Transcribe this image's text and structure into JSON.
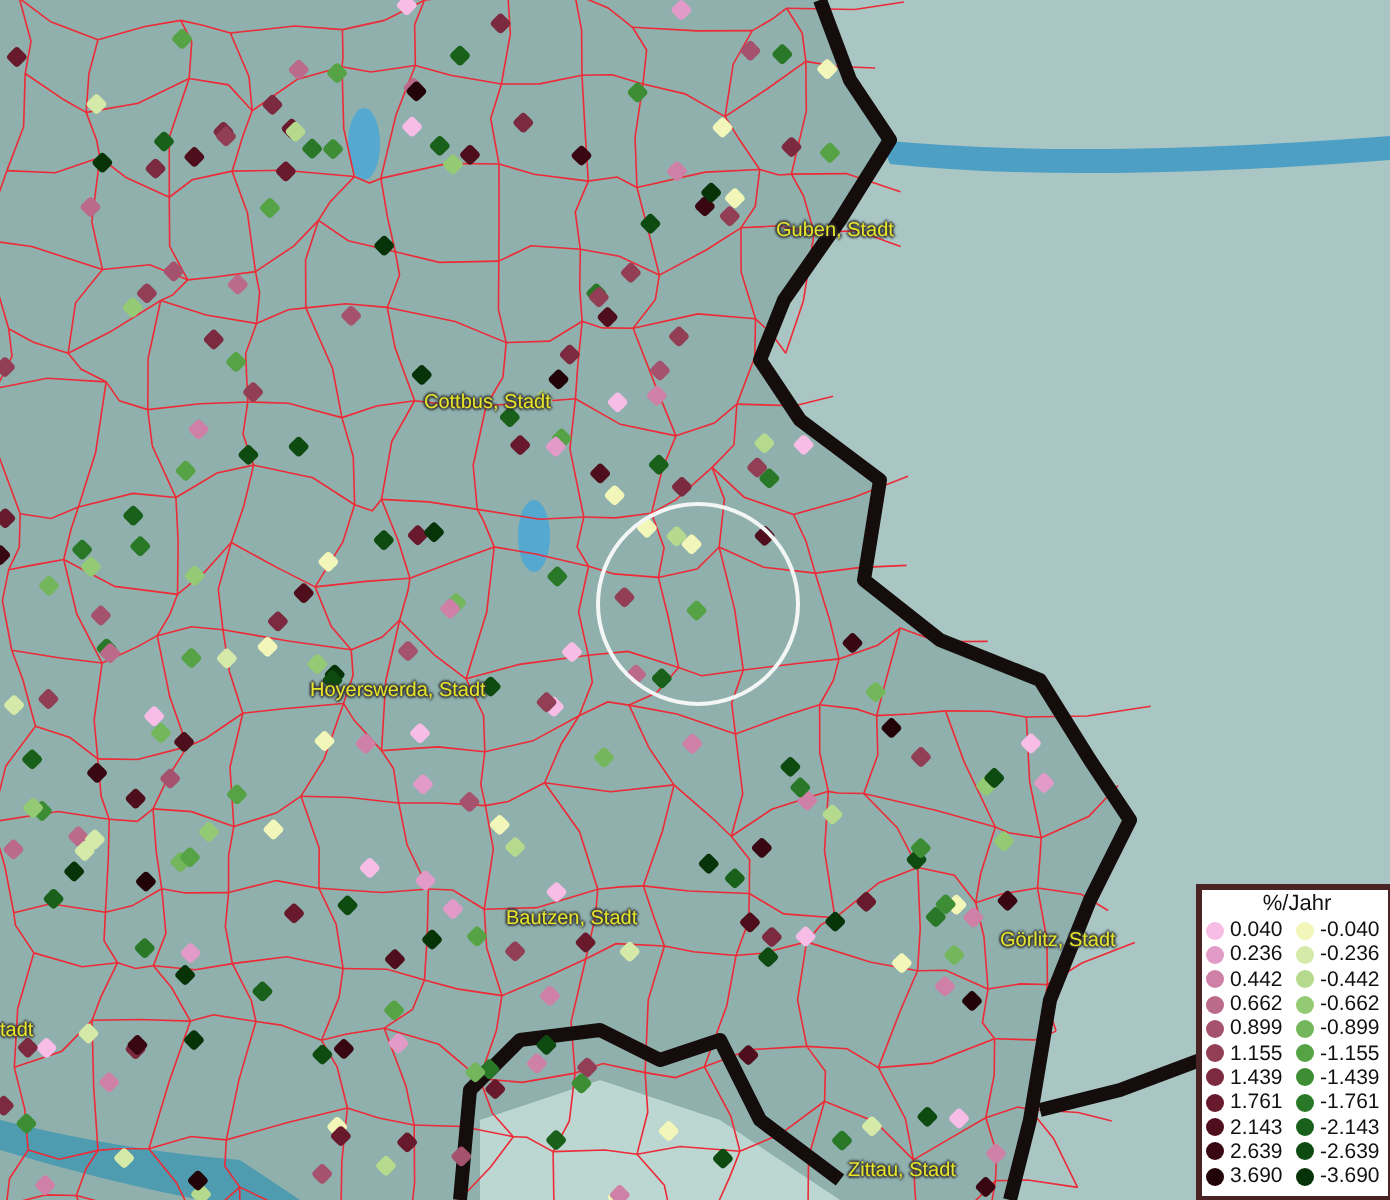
{
  "map": {
    "place_labels": [
      {
        "label": "Guben, Stadt"
      },
      {
        "label": "Cottbus, Stadt"
      },
      {
        "label": "Hoyerswerda, Stadt"
      },
      {
        "label": "tadt"
      },
      {
        "label": "Bautzen, Stadt"
      },
      {
        "label": "Görlitz, Stadt"
      },
      {
        "label": "Zittau, Stadt"
      }
    ]
  },
  "legend": {
    "title": "%/Jahr",
    "positive": [
      {
        "label": "0.040",
        "color": "#f7bde6"
      },
      {
        "label": "0.236",
        "color": "#e29bc8"
      },
      {
        "label": "0.442",
        "color": "#cf80a6"
      },
      {
        "label": "0.662",
        "color": "#bb6a8a"
      },
      {
        "label": "0.899",
        "color": "#a5526e"
      },
      {
        "label": "1.155",
        "color": "#923e55"
      },
      {
        "label": "1.439",
        "color": "#7c2a3f"
      },
      {
        "label": "1.761",
        "color": "#68192b"
      },
      {
        "label": "2.143",
        "color": "#4e0e1b"
      },
      {
        "label": "2.639",
        "color": "#380712"
      },
      {
        "label": "3.690",
        "color": "#210308"
      }
    ],
    "negative": [
      {
        "label": "-0.040",
        "color": "#f2f6b8"
      },
      {
        "label": "-0.236",
        "color": "#d5eaa8"
      },
      {
        "label": "-0.442",
        "color": "#b5da8d"
      },
      {
        "label": "-0.662",
        "color": "#94ca73"
      },
      {
        "label": "-0.899",
        "color": "#74b65b"
      },
      {
        "label": "-1.155",
        "color": "#56a346"
      },
      {
        "label": "-1.439",
        "color": "#3d8d35"
      },
      {
        "label": "-1.761",
        "color": "#297827"
      },
      {
        "label": "-2.143",
        "color": "#19611a"
      },
      {
        "label": "-2.639",
        "color": "#0e4b11"
      },
      {
        "label": "-3.690",
        "color": "#063308"
      }
    ]
  }
}
